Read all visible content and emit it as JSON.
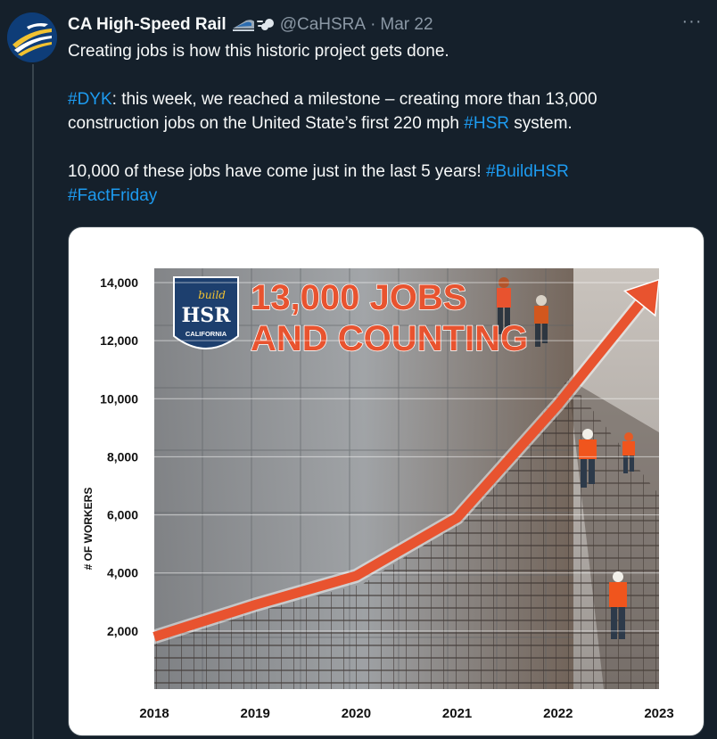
{
  "tweet": {
    "display_name": "CA High-Speed Rail",
    "handle": "@CaHSRA",
    "separator": "·",
    "date": "Mar 22",
    "more_label": "···",
    "text_line1": "Creating jobs is how this historic project gets done.",
    "p2": {
      "tag1": "#DYK",
      "t1": ": this week, we reached a milestone – creating more than 13,000 construction jobs on the United State’s first 220 mph ",
      "tag2": "#HSR",
      "t2": " system."
    },
    "p3": {
      "t1": "10,000 of these jobs have come just in the last 5 years! ",
      "tag1": "#BuildHSR",
      "tag2": "#FactFriday"
    }
  },
  "colors": {
    "link": "#1d9bf0",
    "background": "#15202b",
    "arrow": "#e8532f",
    "badge": "#1d3f6e",
    "muted": "#8b98a5"
  },
  "icons": {
    "avatar": "ca-high-speed-rail-logo",
    "emoji": [
      "high-speed-train-icon",
      "dashing-away-icon"
    ],
    "more": "more-icon"
  },
  "graphic": {
    "headline_1": "13,000 JOBS",
    "headline_2": "AND COUNTING",
    "badge_top": "build",
    "badge_main": "HSR",
    "badge_sub": "CALIFORNIA"
  },
  "chart_data": {
    "type": "line",
    "ylabel": "# OF WORKERS",
    "xlabel": "",
    "x": [
      "2018",
      "2019",
      "2020",
      "2021",
      "2022",
      "2023"
    ],
    "values": [
      1800,
      2900,
      3900,
      5900,
      9800,
      14100
    ],
    "ylim": [
      0,
      14000
    ],
    "yticks": [
      2000,
      4000,
      6000,
      8000,
      10000,
      12000,
      14000
    ],
    "ytick_labels": [
      "2,000",
      "4,000",
      "6,000",
      "8,000",
      "10,000",
      "12,000",
      "14,000"
    ],
    "grid": true,
    "style": "arrow"
  }
}
